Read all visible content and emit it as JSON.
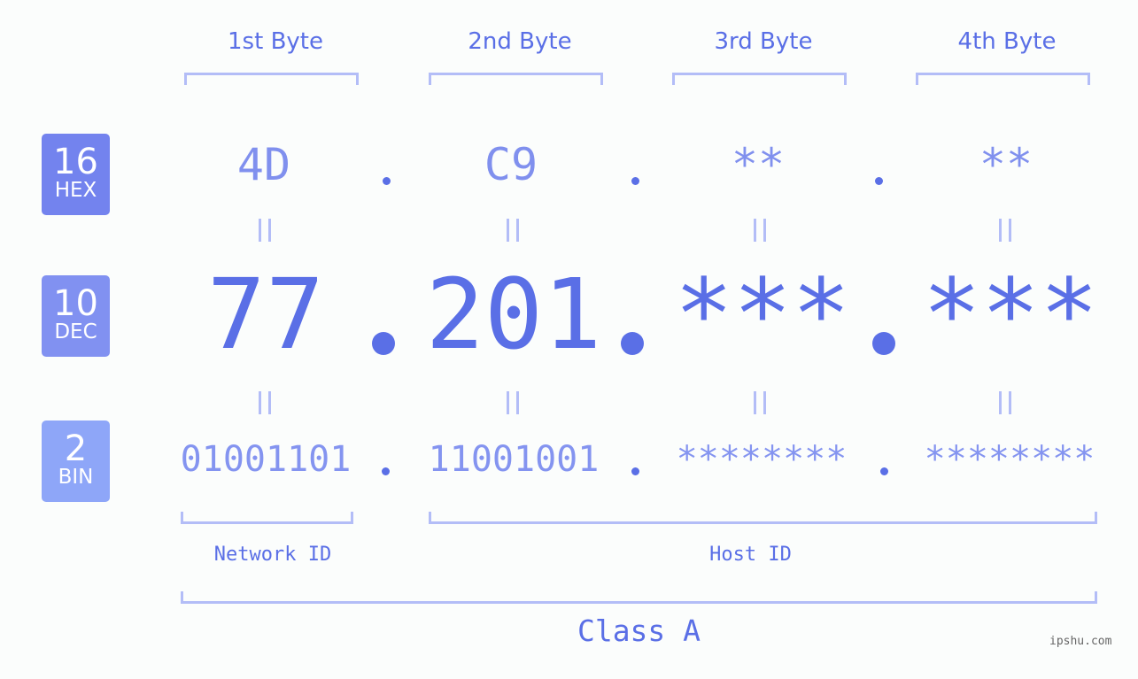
{
  "headers": [
    "1st Byte",
    "2nd Byte",
    "3rd Byte",
    "4th Byte"
  ],
  "bases": [
    {
      "number": "16",
      "label": "HEX",
      "color": "#7383ee"
    },
    {
      "number": "10",
      "label": "DEC",
      "color": "#8191f1"
    },
    {
      "number": "2",
      "label": "BIN",
      "color": "#8ea6f8"
    }
  ],
  "hex": [
    "4D",
    "C9",
    "**",
    "**"
  ],
  "dec": [
    "77",
    "201",
    "***",
    "***"
  ],
  "bin": [
    "01001101",
    "11001001",
    "********",
    "********"
  ],
  "separator": ".",
  "equals_symbol": "=",
  "network_id_label": "Network ID",
  "host_id_label": "Host ID",
  "class_label": "Class A",
  "watermark": "ipshu.com",
  "colors": {
    "primary": "#5a6fe6",
    "bracket": "#b3bdf7",
    "background": "#fbfdfc"
  }
}
